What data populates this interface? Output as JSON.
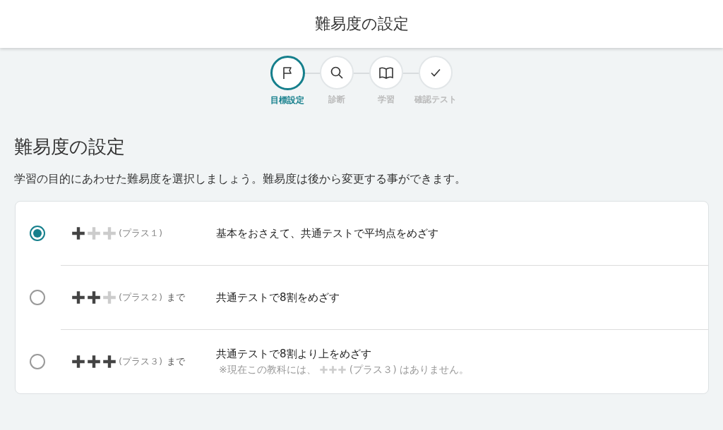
{
  "header": {
    "title": "難易度の設定"
  },
  "steps": [
    {
      "label": "目標設定",
      "kind": "flag",
      "selected": true
    },
    {
      "label": "診断",
      "kind": "search",
      "selected": false
    },
    {
      "label": "学習",
      "kind": "book",
      "selected": false
    },
    {
      "label": "確認テスト",
      "kind": "check",
      "selected": false
    }
  ],
  "heading": "難易度の設定",
  "description": "学習の目的にあわせた難易度を選択しましょう。難易度は後から変更する事ができます。",
  "options": [
    {
      "selected": true,
      "stars": 1,
      "level_label": "(プラス１)",
      "goal": "基本をおさえて、共通テストで平均点をめざす"
    },
    {
      "selected": false,
      "stars": 2,
      "level_label": "(プラス２)",
      "suffix": "まで",
      "goal": "共通テストで8割をめざす"
    },
    {
      "selected": false,
      "stars": 3,
      "level_label": "(プラス３)",
      "suffix": "まで",
      "goal": "共通テストで8割より上をめざす",
      "note_before": "※現在この教科には、",
      "note_after": "(プラス３) はありません。"
    }
  ]
}
